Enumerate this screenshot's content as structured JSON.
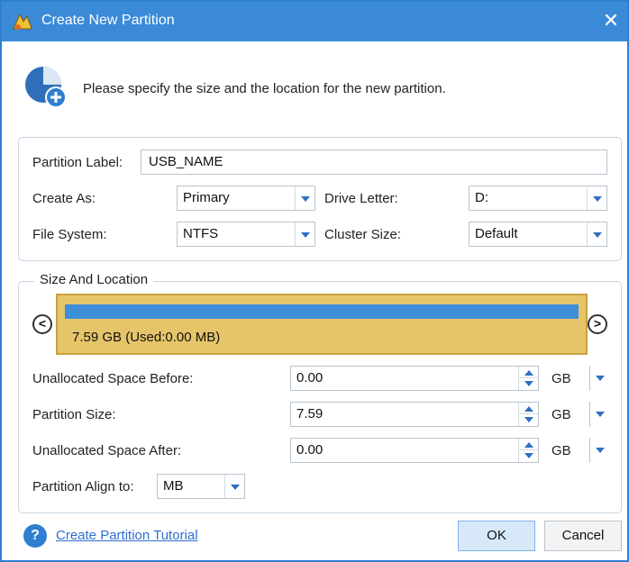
{
  "window": {
    "title": "Create New Partition",
    "close_glyph": "✕",
    "title_icon": "minitool-app-icon",
    "accent": "#3a8ad8"
  },
  "header": {
    "icon": "pie-add-icon",
    "instruction": "Please specify the size and the location for the new partition."
  },
  "partition": {
    "label_caption": "Partition Label:",
    "label_value": "USB_NAME",
    "create_as_caption": "Create As:",
    "create_as_value": "Primary",
    "drive_letter_caption": "Drive Letter:",
    "drive_letter_value": "D:",
    "file_system_caption": "File System:",
    "file_system_value": "NTFS",
    "cluster_size_caption": "Cluster Size:",
    "cluster_size_value": "Default"
  },
  "size_location": {
    "legend": "Size And Location",
    "bar_text": "7.59 GB (Used:0.00 MB)",
    "bar_color": "#e6c46a",
    "used_color": "#3d8ed9",
    "nav_left": "<",
    "nav_right": ">",
    "unalloc_before_caption": "Unallocated Space Before:",
    "unalloc_before_value": "0.00",
    "unalloc_before_unit": "GB",
    "partition_size_caption": "Partition Size:",
    "partition_size_value": "7.59",
    "partition_size_unit": "GB",
    "unalloc_after_caption": "Unallocated Space After:",
    "unalloc_after_value": "0.00",
    "unalloc_after_unit": "GB",
    "align_caption": "Partition Align to:",
    "align_value": "MB"
  },
  "footer": {
    "help_glyph": "?",
    "tutorial_link": "Create Partition Tutorial",
    "ok_label": "OK",
    "cancel_label": "Cancel"
  }
}
